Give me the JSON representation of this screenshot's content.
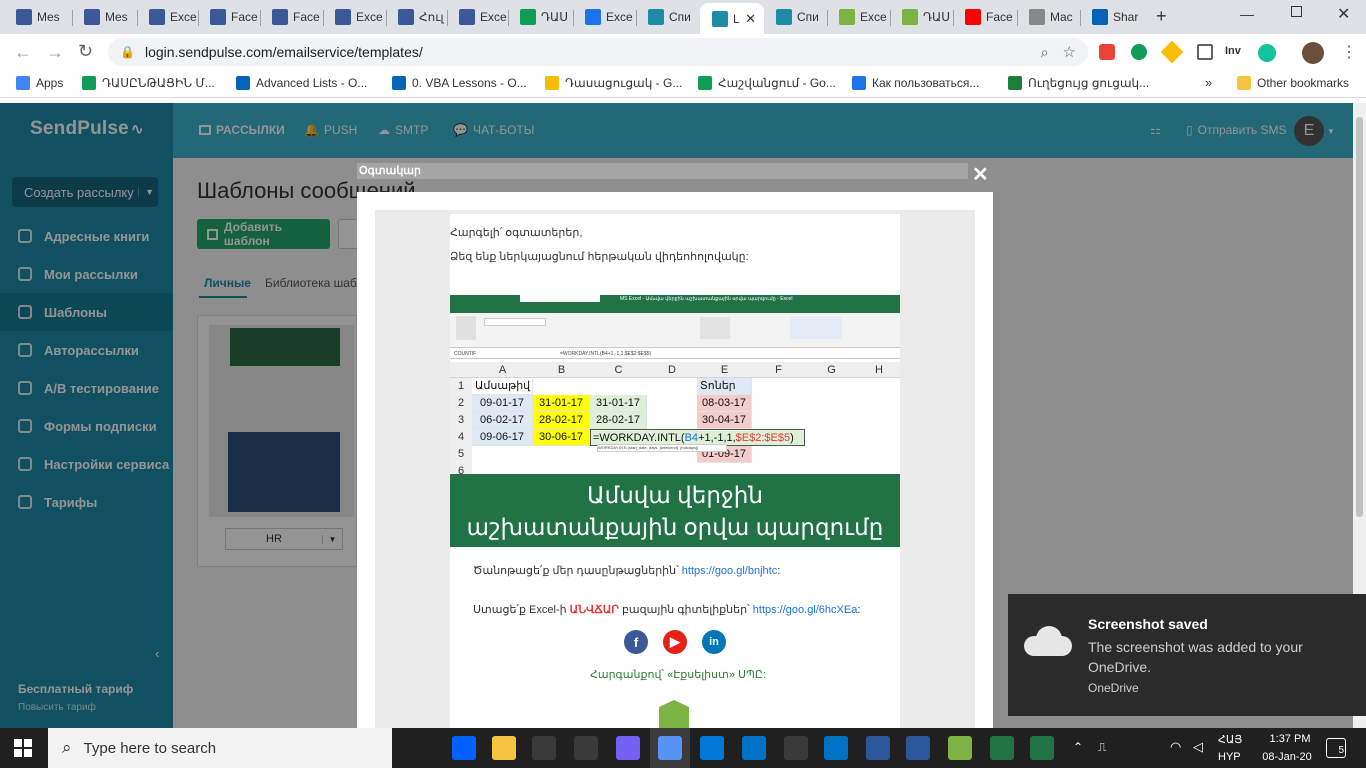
{
  "browser": {
    "tabs": [
      {
        "label": "Mes",
        "icon": "facebook-icon",
        "color": "#3b5998"
      },
      {
        "label": "Mes",
        "icon": "facebook-icon",
        "color": "#3b5998"
      },
      {
        "label": "Exce",
        "icon": "facebook-icon",
        "color": "#3b5998"
      },
      {
        "label": "Face",
        "icon": "facebook-icon",
        "color": "#3b5998"
      },
      {
        "label": "Face",
        "icon": "facebook-icon",
        "color": "#3b5998"
      },
      {
        "label": "Exce",
        "icon": "facebook-icon",
        "color": "#3b5998"
      },
      {
        "label": "Հուլ",
        "icon": "facebook-icon",
        "color": "#3b5998"
      },
      {
        "label": "Exce",
        "icon": "facebook-icon",
        "color": "#3b5998"
      },
      {
        "label": "ԴԱՍ",
        "icon": "sheets-plus-icon",
        "color": "#0f9d58"
      },
      {
        "label": "Exce",
        "icon": "excel-doc-icon",
        "color": "#1a73e8"
      },
      {
        "label": "Спи",
        "icon": "sendpulse-icon",
        "color": "#1e8ba8"
      },
      {
        "label": "L",
        "icon": "sendpulse-icon",
        "color": "#1e8ba8"
      },
      {
        "label": "Спи",
        "icon": "sendpulse-icon",
        "color": "#1e8ba8"
      },
      {
        "label": "Exce",
        "icon": "excelist-icon",
        "color": "#7cb342"
      },
      {
        "label": "ԴԱՍ",
        "icon": "excelist-icon",
        "color": "#7cb342"
      },
      {
        "label": "Face",
        "icon": "youtube-icon",
        "color": "#ff0000"
      },
      {
        "label": "Mac",
        "icon": "doc-icon",
        "color": "#888888"
      },
      {
        "label": "Shar",
        "icon": "onedrive-icon",
        "color": "#0364b8"
      }
    ],
    "url": "login.sendpulse.com/emailservice/templates/",
    "extensions": [
      "Inv"
    ],
    "profile_letter": "",
    "bookmarks": [
      {
        "label": "Apps",
        "icon": "apps-grid-icon"
      },
      {
        "label": "ԴԱՍԸՆԹԱՑԻՆ Մ...",
        "icon": "sheets-plus-icon"
      },
      {
        "label": "Advanced Lists - O...",
        "icon": "onedrive-icon"
      },
      {
        "label": "0. VBA Lessons - O...",
        "icon": "onedrive-icon"
      },
      {
        "label": "Դասացուցակ - G...",
        "icon": "drive-icon"
      },
      {
        "label": "Հաշվանցում - Go...",
        "icon": "sheets-plus-icon"
      },
      {
        "label": "Как пользоваться...",
        "icon": "excel-doc-icon"
      },
      {
        "label": "Ուղեցույց ցուցակ...",
        "icon": "excel-x-icon"
      }
    ],
    "other_bookmarks": "Other bookmarks"
  },
  "app": {
    "logo": "SendPulse",
    "create_button": "Создать рассылку",
    "sidebar": [
      {
        "label": "Адресные книги"
      },
      {
        "label": "Мои рассылки"
      },
      {
        "label": "Шаблоны"
      },
      {
        "label": "Авторассылки"
      },
      {
        "label": "A/B тестирование"
      },
      {
        "label": "Формы подписки"
      },
      {
        "label": "Настройки сервиса"
      },
      {
        "label": "Тарифы"
      }
    ],
    "plan_title": "Бесплатный тариф",
    "plan_sub": "Повысить тариф",
    "nav": [
      "РАССЫЛКИ",
      "PUSH",
      "SMTP",
      "ЧАТ-БОТЫ"
    ],
    "send_sms": "Отправить SMS",
    "avatar": "E",
    "page_title": "Шаблоны сообщений",
    "add_template": "Добавить шаблон",
    "tab_personal": "Личные",
    "tab_library": "Библиотека шабл",
    "template_name": "HR"
  },
  "modal": {
    "title": "Օգտակար",
    "greeting": "Հարգելի՛ օգտատերեր,",
    "intro": "Ձեզ ենք ներկայացնում հերթական վիդեոհոլովակը:",
    "excel": {
      "title_bar": "MS Excel - Ամսվա վերջին աշխատանքային օրվա պարզումը - Excel",
      "name_box": "COUNTIF",
      "formula_bar": "=WORKDAY.INTL(B4+1,-1,1,$E$2:$E$5)",
      "columns": [
        "A",
        "B",
        "C",
        "D",
        "E",
        "F",
        "G",
        "H"
      ],
      "rows": [
        "1",
        "2",
        "3",
        "4",
        "5",
        "6"
      ],
      "header_a1": "Ամսաթիվ",
      "header_e1": "Տոներ",
      "col_a": [
        "09-01-17",
        "06-02-17",
        "09-06-17"
      ],
      "col_b": [
        "31-01-17",
        "28-02-17",
        "30-06-17"
      ],
      "col_c": [
        "31-01-17",
        "28-02-17"
      ],
      "col_e": [
        "08-03-17",
        "30-04-17",
        "01-09-17"
      ],
      "formula_cell_pre": "=WORKDAY.INTL(",
      "formula_cell_ref": "B4",
      "formula_cell_mid": "+1,-1,1,",
      "formula_cell_range": "$E$2:$E$5",
      "formula_cell_post": ")",
      "tooltip": "WORKDAY.INTL(start_date, days, [weekend], [holidays])"
    },
    "banner_line1": "Ամսվա վերջին",
    "banner_line2": "աշխատանքային օրվա պարզումը",
    "follow_text": "Ծանոթացե՛ք մեր դասընթացներին՝",
    "follow_link": "https://goo.gl/bnjhtc",
    "get_text_pre": "Ստացե՛ք Excel-ի",
    "get_text_free": "ԱՆՎՃԱՐ",
    "get_text_post": "բազային գիտելիքներ՝",
    "get_link": "https://goo.gl/6hcXEa",
    "regards": "Հարգանքով՝ «Էքսելիստ» ՍՊԸ:"
  },
  "notification": {
    "title": "Screenshot saved",
    "body": "The screenshot was added to your OneDrive.",
    "source": "OneDrive"
  },
  "taskbar": {
    "search_placeholder": "Type here to search",
    "lang": "ՀԱՅ",
    "layout": "HYP",
    "time": "1:37 PM",
    "date": "08-Jan-20",
    "notif_count": "5"
  },
  "colors": {
    "sidebar": "#1e8ba8",
    "topnav": "#3bb3cb",
    "excel_green": "#217346",
    "add_button": "#21a869"
  }
}
